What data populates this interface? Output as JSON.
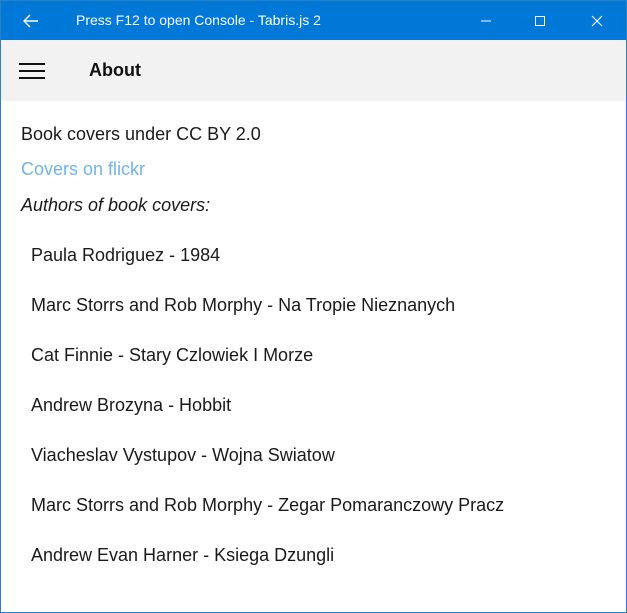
{
  "window": {
    "title": "Press F12 to open Console - Tabris.js 2",
    "icons": {
      "back": "back-arrow-icon",
      "minimize": "minimize-icon",
      "maximize": "maximize-icon",
      "close": "close-icon"
    },
    "colors": {
      "titlebar": "#0078d7",
      "appbar": "#f2f2f2",
      "link": "#6fb4e6"
    }
  },
  "header": {
    "title": "About",
    "menu_icon": "hamburger-menu-icon"
  },
  "content": {
    "license_text": "Book covers under CC BY 2.0",
    "link_text": "Covers on flickr",
    "authors_heading": "Authors of book covers:",
    "authors": [
      "Paula Rodriguez - 1984",
      "Marc Storrs and Rob Morphy - Na Tropie Nieznanych",
      "Cat Finnie - Stary Czlowiek I Morze",
      "Andrew Brozyna - Hobbit",
      "Viacheslav Vystupov - Wojna Swiatow",
      "Marc Storrs and Rob Morphy - Zegar Pomaranczowy Pracz",
      "Andrew Evan Harner - Ksiega Dzungli"
    ]
  }
}
